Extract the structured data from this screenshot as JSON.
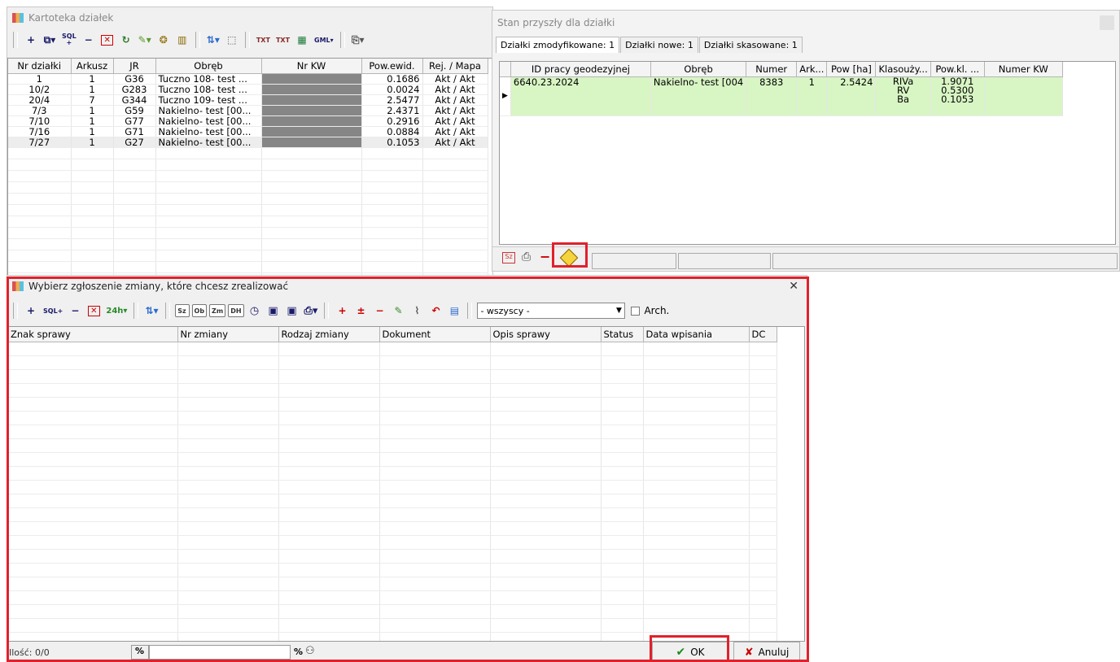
{
  "kartoteka": {
    "title": "Kartoteka działek",
    "toolbar_icons": [
      "add-icon",
      "tree-icon",
      "sql-icon",
      "remove-icon",
      "delete-icon",
      "spiral-icon",
      "pencil-icon",
      "globe-icon",
      "book-icon",
      "sort-icon",
      "select-icon",
      "txt-icon",
      "txt-icon",
      "excel-icon",
      "gml-icon",
      "export-icon"
    ],
    "toolbar_glyphs": {
      "add": "+",
      "sql": "SQL",
      "remove": "−",
      "delete": "✕",
      "sort": "⇅",
      "txt": "TXT",
      "gml": "GML"
    },
    "columns": [
      "Nr działki",
      "Arkusz",
      "JR",
      "Obręb",
      "Nr KW",
      "Pow.ewid.",
      "Rej. / Mapa"
    ],
    "rows": [
      [
        "1",
        "1",
        "G36",
        "Tuczno 108- test ...",
        "",
        "0.1686",
        "Akt / Akt"
      ],
      [
        "10/2",
        "1",
        "G283",
        "Tuczno 108- test ...",
        "",
        "0.0024",
        "Akt / Akt"
      ],
      [
        "20/4",
        "7",
        "G344",
        "Tuczno 109- test ...",
        "",
        "2.5477",
        "Akt / Akt"
      ],
      [
        "7/3",
        "1",
        "G59",
        "Nakielno- test [00...",
        "",
        "2.4371",
        "Akt / Akt"
      ],
      [
        "7/10",
        "1",
        "G77",
        "Nakielno- test [00...",
        "",
        "0.2916",
        "Akt / Akt"
      ],
      [
        "7/16",
        "1",
        "G71",
        "Nakielno- test [00...",
        "",
        "0.0884",
        "Akt / Akt"
      ],
      [
        "7/27",
        "1",
        "G27",
        "Nakielno- test [00...",
        "",
        "0.1053",
        "Akt / Akt"
      ]
    ]
  },
  "stan": {
    "title": "Stan przyszły dla działki",
    "tabs": [
      "Działki zmodyfikowane: 1",
      "Działki nowe: 1",
      "Działki skasowane: 1"
    ],
    "columns": [
      "ID pracy geodezyjnej",
      "Obręb",
      "Numer",
      "Ark...",
      "Pow [ha]",
      "Klasouży...",
      "Pow.kl. ...",
      "Numer KW"
    ],
    "row": {
      "id": "6640.23.2024",
      "obreb": "Nakielno- test [004",
      "numer": "8383",
      "ark": "1",
      "pow": "2.5424",
      "klasy": [
        "RIVa",
        "RV",
        "Ba"
      ],
      "pow_kl": [
        "1.9071",
        "0.5300",
        "0.1053"
      ],
      "kw": ""
    },
    "status_icons": [
      "report-icon",
      "print-icon",
      "minus-icon",
      "warning-diamond-icon"
    ],
    "highlight_color": "#d8f5c4"
  },
  "wybierz": {
    "title": "Wybierz zgłoszenie zmiany, które chcesz zrealizować",
    "close": "✕",
    "filter_value": "- wszyscy -",
    "arch_label": "Arch.",
    "columns": [
      "Znak sprawy",
      "Nr zmiany",
      "Rodzaj zmiany",
      "Dokument",
      "Opis sprawy",
      "Status",
      "Data wpisania",
      "DC"
    ],
    "small_buttons": [
      "Sz",
      "Ob",
      "Zm",
      "DH"
    ],
    "count_label": "Ilość: 0/0",
    "search_prefix": "%",
    "search_suffix": "%",
    "ok_label": "OK",
    "cancel_label": "Anuluj"
  },
  "colors": {
    "highlight_red": "#e0212c",
    "row_green": "#d8f5c4"
  }
}
